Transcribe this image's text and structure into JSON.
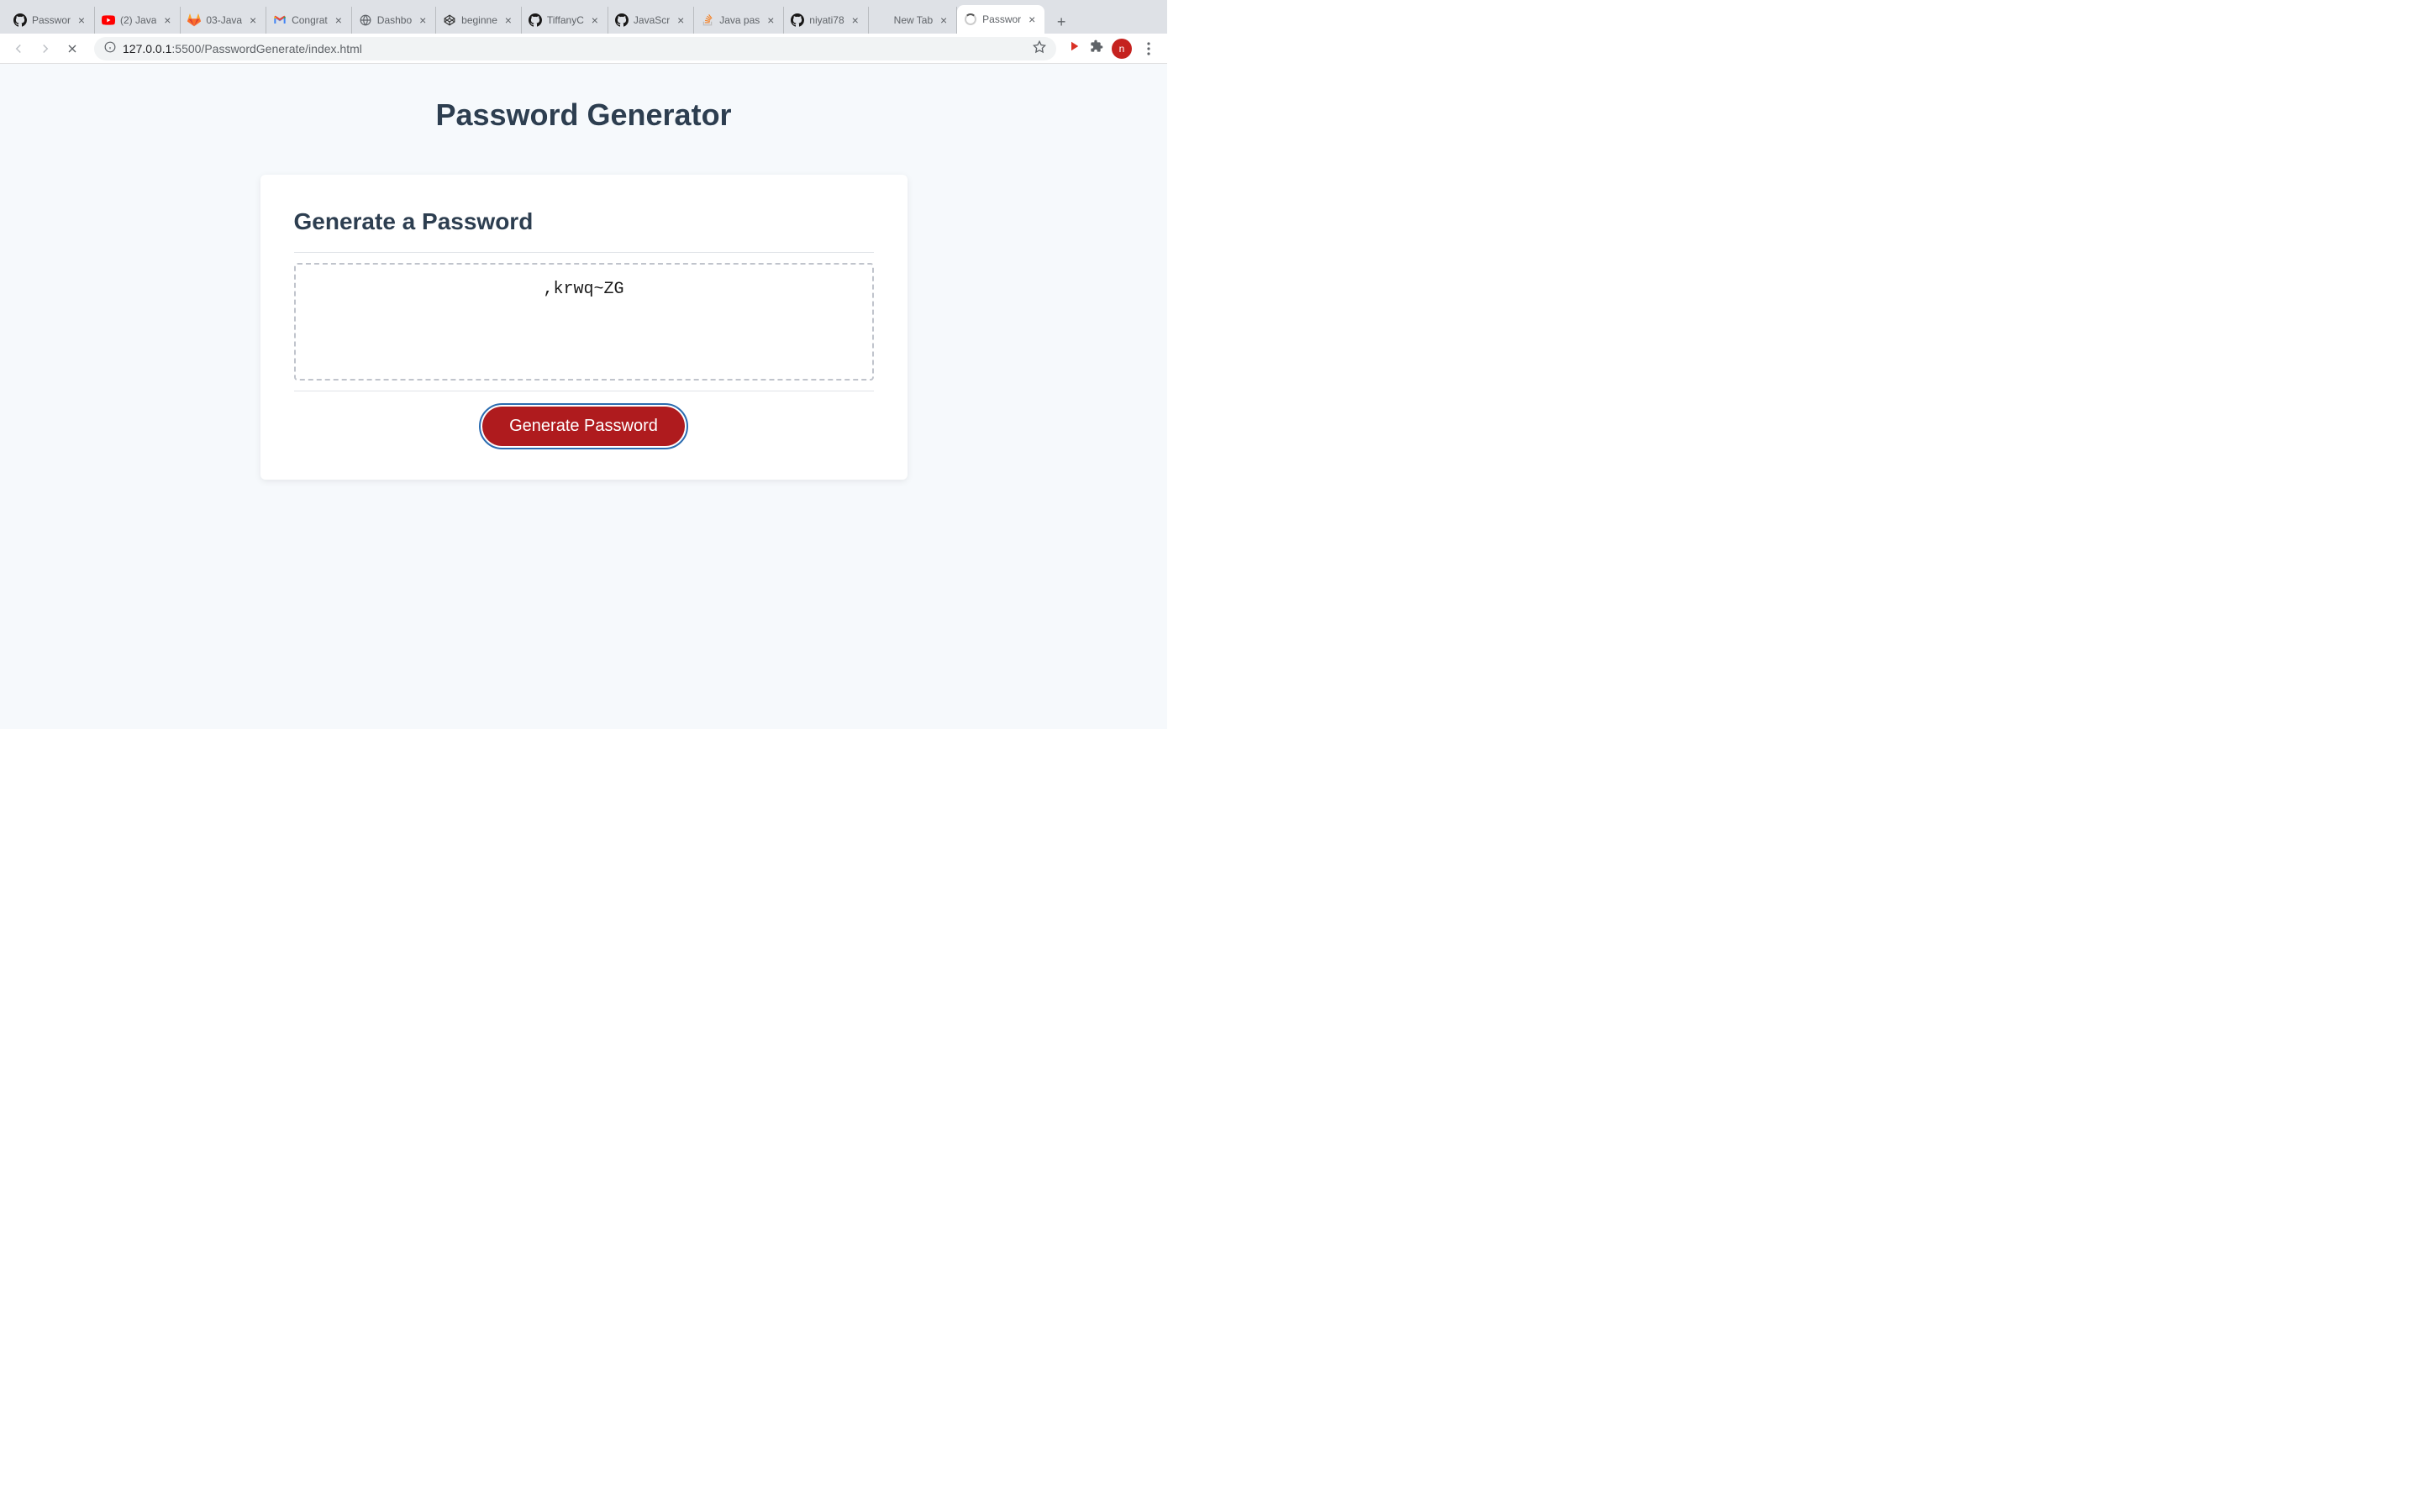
{
  "browser": {
    "tabs": [
      {
        "title": "Passwor",
        "favicon": "github"
      },
      {
        "title": "(2) Java",
        "favicon": "youtube"
      },
      {
        "title": "03-Java",
        "favicon": "gitlab"
      },
      {
        "title": "Congrat",
        "favicon": "gmail"
      },
      {
        "title": "Dashbo",
        "favicon": "globe"
      },
      {
        "title": "beginne",
        "favicon": "codepen"
      },
      {
        "title": "TiffanyC",
        "favicon": "github"
      },
      {
        "title": "JavaScr",
        "favicon": "github"
      },
      {
        "title": "Java pas",
        "favicon": "stackoverflow"
      },
      {
        "title": "niyati78",
        "favicon": "github"
      },
      {
        "title": "New Tab",
        "favicon": "none"
      },
      {
        "title": "Passwor",
        "favicon": "loading",
        "active": true
      }
    ],
    "url_host": "127.0.0.1",
    "url_port_path": ":5500/PasswordGenerate/index.html",
    "profile_letter": "n"
  },
  "page": {
    "main_title": "Password Generator",
    "card_title": "Generate a Password",
    "password_value": ",krwq~ZG",
    "button_label": "Generate Password"
  }
}
